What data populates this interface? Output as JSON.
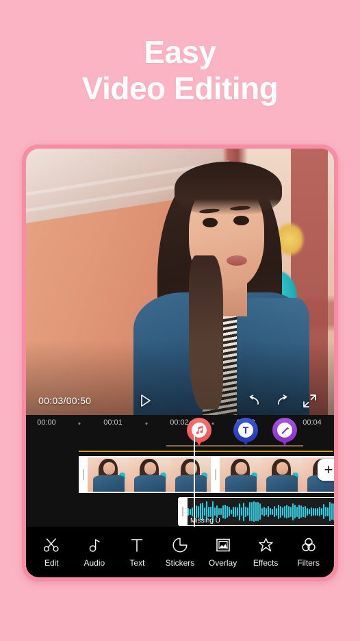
{
  "headline": {
    "line1": "Easy",
    "line2": "Video Editing"
  },
  "colors": {
    "background": "#fbb4c4",
    "phone_frame": "#f88ca4",
    "screen": "#000000",
    "waveform": "#19d3e8",
    "pin_music": "#ef5454",
    "pin_text": "#2438b8",
    "pin_effect": "#8a2fc8"
  },
  "player": {
    "time_display": "00:03/00:50",
    "current_time": "00:03",
    "total_time": "00:50",
    "controls": [
      {
        "name": "play-button",
        "icon": "play-icon"
      },
      {
        "name": "undo-button",
        "icon": "undo-icon"
      },
      {
        "name": "redo-button",
        "icon": "redo-icon"
      },
      {
        "name": "fullscreen-button",
        "icon": "expand-icon"
      }
    ]
  },
  "timeline": {
    "ruler_labels": [
      "00:00",
      "00:01",
      "00:02",
      "00:03",
      "00:04"
    ],
    "markers": [
      {
        "type": "music",
        "icon": "music-note-icon",
        "glyph": "♫",
        "label": ""
      },
      {
        "type": "text",
        "icon": "text-marker-icon",
        "glyph": "T",
        "label": ""
      },
      {
        "type": "effect",
        "icon": "magic-wand-icon",
        "glyph": "✦",
        "label": ""
      }
    ],
    "video_clip": {
      "name": "video-clip",
      "frames": 7
    },
    "audio_clip": {
      "title": "Missing U"
    },
    "add_button_label": "+"
  },
  "toolbar": {
    "items": [
      {
        "label": "Edit",
        "icon": "scissors-icon"
      },
      {
        "label": "Audio",
        "icon": "music-note-icon"
      },
      {
        "label": "Text",
        "icon": "text-t-icon"
      },
      {
        "label": "Stickers",
        "icon": "sticker-icon"
      },
      {
        "label": "Overlay",
        "icon": "picture-frame-icon"
      },
      {
        "label": "Effects",
        "icon": "sparkle-star-icon"
      },
      {
        "label": "Filters",
        "icon": "three-circles-icon"
      }
    ]
  }
}
